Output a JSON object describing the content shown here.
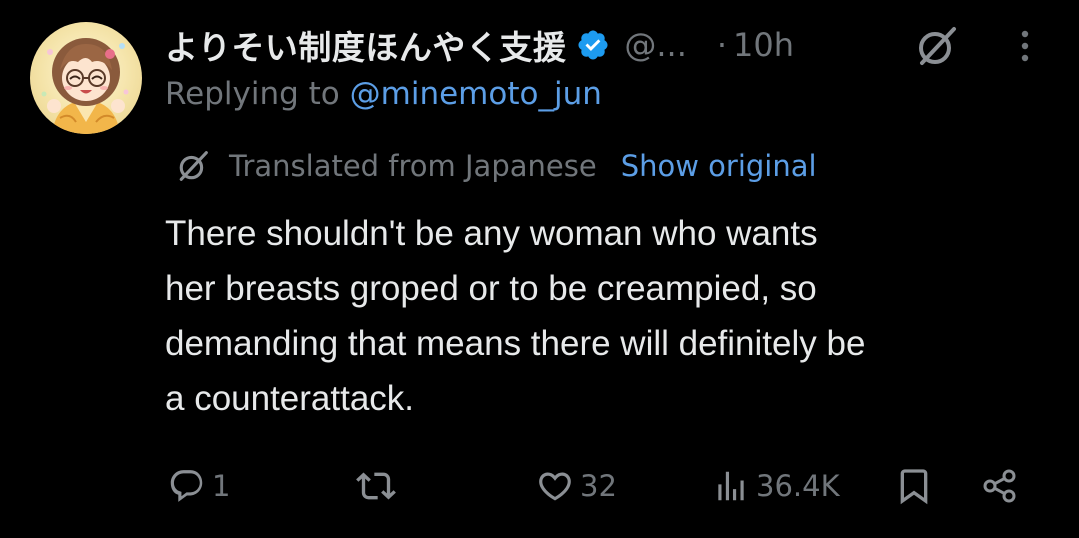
{
  "author": {
    "display_name": "よりそい制度ほんやく支援",
    "handle": "@...",
    "separator": "·",
    "timestamp": "10h",
    "verified": true
  },
  "reply": {
    "label": "Replying to",
    "mention": "@minemoto_jun"
  },
  "translation": {
    "label": "Translated from Japanese",
    "show_original": "Show original"
  },
  "body": {
    "lines": [
      "There shouldn't be any woman who wants",
      "her breasts groped or to be creampied, so",
      "demanding that means there will definitely be",
      "a counterattack."
    ]
  },
  "actions": {
    "replies": "1",
    "reposts": "",
    "likes": "32",
    "views": "36.4K"
  },
  "colors": {
    "background": "#000000",
    "text_primary": "#e7e9ea",
    "text_secondary": "#71767b",
    "link": "#5c9ee6",
    "verified_badge": "#1d9bf0"
  },
  "icons": {
    "verified": "verified-badge-icon",
    "grok": "grok-icon",
    "more": "more-vertical-icon",
    "translate": "grok-translate-icon",
    "reply": "reply-icon",
    "repost": "repost-icon",
    "like": "heart-icon",
    "views": "views-chart-icon",
    "bookmark": "bookmark-icon",
    "share": "share-icon"
  }
}
